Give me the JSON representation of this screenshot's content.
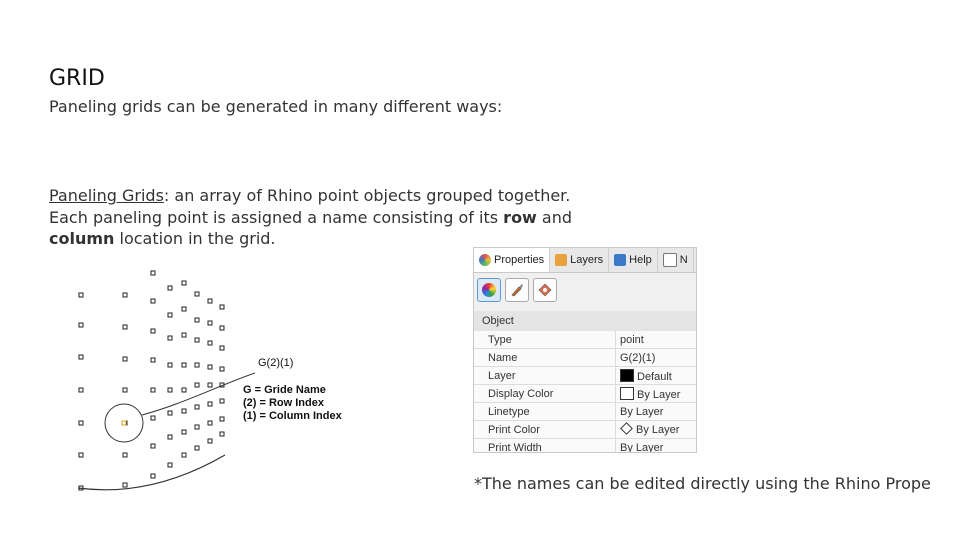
{
  "title": "GRID",
  "subtitle": "Paneling grids can be generated in many different ways:",
  "body": {
    "term": "Paneling Grids",
    "line1_rest": ": an array of Rhino point objects grouped together.",
    "line2_pre": "Each paneling point is assigned a name consisting of its ",
    "row_word": "row",
    "and_word": " and ",
    "column_word": "column",
    "line2_post": " location in the grid."
  },
  "diagram": {
    "point_label": "G(2)(1)",
    "legend": [
      "G = Gride Name",
      "(2) = Row Index",
      "(1) = Column Index"
    ]
  },
  "properties_panel": {
    "tabs": [
      {
        "label": "Properties",
        "icon": "properties-icon",
        "color": "#d9534f"
      },
      {
        "label": "Layers",
        "icon": "layers-icon",
        "color": "#e8a33d"
      },
      {
        "label": "Help",
        "icon": "help-icon",
        "color": "#3c78c8"
      },
      {
        "label": "N",
        "icon": "notes-icon",
        "color": "#777777"
      }
    ],
    "section": "Object",
    "rows": [
      {
        "name": "Type",
        "value": "point",
        "swatch": ""
      },
      {
        "name": "Name",
        "value": "G(2)(1)",
        "swatch": ""
      },
      {
        "name": "Layer",
        "value": "Default",
        "swatch": "black"
      },
      {
        "name": "Display Color",
        "value": "By Layer",
        "swatch": "white"
      },
      {
        "name": "Linetype",
        "value": "By Layer",
        "swatch": ""
      },
      {
        "name": "Print Color",
        "value": "By Layer",
        "swatch": "diamond"
      },
      {
        "name": "Print Width",
        "value": "By Layer",
        "swatch": ""
      }
    ]
  },
  "footnote": "*The names can be edited directly using the Rhino Prope"
}
